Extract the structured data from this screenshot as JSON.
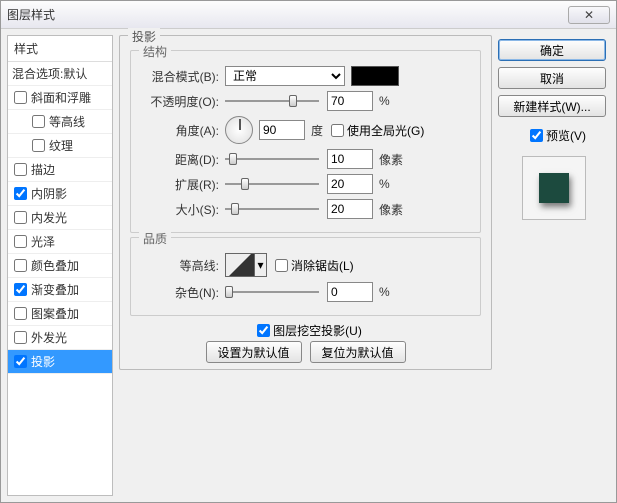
{
  "window": {
    "title": "图层样式",
    "close": "✕"
  },
  "sidebar": {
    "header": "样式",
    "blend": "混合选项:默认",
    "items": [
      {
        "label": "斜面和浮雕",
        "checked": false,
        "indent": false
      },
      {
        "label": "等高线",
        "checked": false,
        "indent": true
      },
      {
        "label": "纹理",
        "checked": false,
        "indent": true
      },
      {
        "label": "描边",
        "checked": false,
        "indent": false
      },
      {
        "label": "内阴影",
        "checked": true,
        "indent": false
      },
      {
        "label": "内发光",
        "checked": false,
        "indent": false
      },
      {
        "label": "光泽",
        "checked": false,
        "indent": false
      },
      {
        "label": "颜色叠加",
        "checked": false,
        "indent": false
      },
      {
        "label": "渐变叠加",
        "checked": true,
        "indent": false
      },
      {
        "label": "图案叠加",
        "checked": false,
        "indent": false
      },
      {
        "label": "外发光",
        "checked": false,
        "indent": false
      },
      {
        "label": "投影",
        "checked": true,
        "indent": false,
        "selected": true
      }
    ]
  },
  "panel": {
    "title": "投影",
    "structure": {
      "title": "结构",
      "blend_label": "混合模式(B):",
      "blend_value": "正常",
      "opacity_label": "不透明度(O):",
      "opacity_value": "70",
      "opacity_unit": "%",
      "angle_label": "角度(A):",
      "angle_value": "90",
      "angle_unit": "度",
      "global_label": "使用全局光(G)",
      "distance_label": "距离(D):",
      "distance_value": "10",
      "distance_unit": "像素",
      "spread_label": "扩展(R):",
      "spread_value": "20",
      "spread_unit": "%",
      "size_label": "大小(S):",
      "size_value": "20",
      "size_unit": "像素"
    },
    "quality": {
      "title": "品质",
      "contour_label": "等高线:",
      "aa_label": "消除锯齿(L)",
      "noise_label": "杂色(N):",
      "noise_value": "0",
      "noise_unit": "%"
    },
    "knockout_label": "图层挖空投影(U)",
    "reset_default": "设置为默认值",
    "restore_default": "复位为默认值"
  },
  "right": {
    "ok": "确定",
    "cancel": "取消",
    "new_style": "新建样式(W)...",
    "preview_label": "预览(V)"
  },
  "colors": {
    "swatch": "#000000",
    "preview_fill": "#1c4a3e"
  }
}
